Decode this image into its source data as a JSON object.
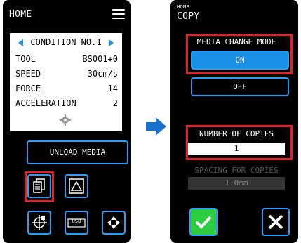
{
  "left_screen": {
    "title": "HOME",
    "condition": "CONDITION NO.1",
    "rows": [
      {
        "k": "TOOL",
        "v": "BS001+0"
      },
      {
        "k": "SPEED",
        "v": "30cm/s"
      },
      {
        "k": "FORCE",
        "v": "14"
      },
      {
        "k": "ACCELERATION",
        "v": "2"
      }
    ],
    "unload_label": "UNLOAD MEDIA",
    "usb_label": "USB"
  },
  "right_screen": {
    "breadcrumb": "HOME",
    "title": "COPY",
    "media_change_label": "MEDIA CHANGE MODE",
    "on_label": "ON",
    "off_label": "OFF",
    "copies_label": "NUMBER OF COPIES",
    "copies_value": "1",
    "spacing_label": "SPACING FOR COPIES",
    "spacing_value": "1.0mm"
  },
  "colors": {
    "accent": "#2a9df4",
    "highlight": "#e0202a",
    "on_fill": "#1a8fe6",
    "ok": "#2ecc40"
  },
  "icons": {
    "menu": "menu-icon",
    "gear": "gear-icon",
    "copy": "copy-icon",
    "triangle": "triangle-icon",
    "origin": "origin-icon",
    "usb": "usb-icon",
    "move": "move-arrows-icon",
    "next": "right-arrow-icon",
    "check": "check-icon",
    "close": "close-icon"
  }
}
